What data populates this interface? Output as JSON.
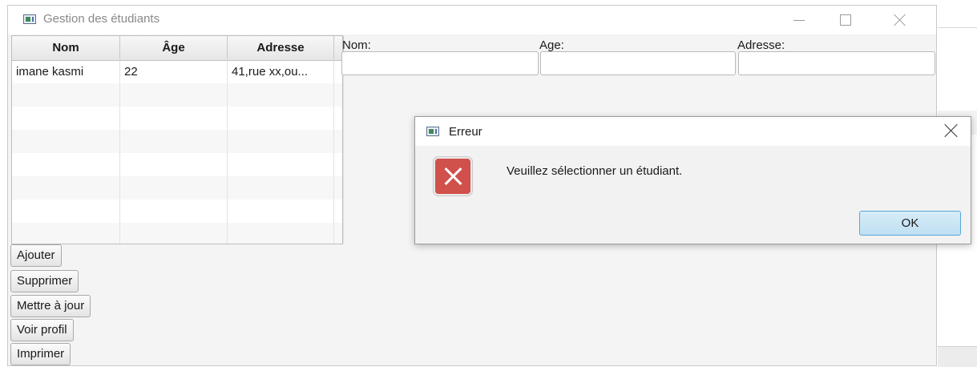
{
  "main_window": {
    "title": "Gestion des étudiants"
  },
  "table": {
    "columns": [
      "Nom",
      "Âge",
      "Adresse"
    ],
    "rows": [
      [
        "imane kasmi",
        "22",
        "41,rue xx,ou..."
      ]
    ]
  },
  "form": {
    "nom_label": "Nom:",
    "age_label": "Age:",
    "adresse_label": "Adresse:"
  },
  "buttons": {
    "add": "Ajouter",
    "delete": "Supprimer",
    "update": "Mettre à jour",
    "profile": "Voir profil",
    "print": "Imprimer"
  },
  "dialog": {
    "title": "Erreur",
    "message": "Veuillez sélectionner un étudiant.",
    "ok_label": "OK"
  },
  "colors": {
    "error_icon": "#d0504c",
    "ok_button_border": "#5aa6d6"
  }
}
